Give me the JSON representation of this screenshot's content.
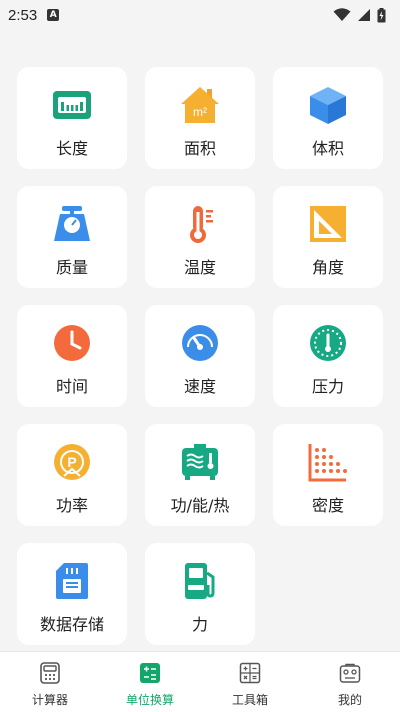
{
  "status_bar": {
    "time": "2:53",
    "notification_icon": "a-notification-icon"
  },
  "units": [
    {
      "label": "长度",
      "icon": "ruler-icon"
    },
    {
      "label": "面积",
      "icon": "house-area-icon"
    },
    {
      "label": "体积",
      "icon": "cube-icon"
    },
    {
      "label": "质量",
      "icon": "scale-icon"
    },
    {
      "label": "温度",
      "icon": "thermometer-icon"
    },
    {
      "label": "角度",
      "icon": "set-square-icon"
    },
    {
      "label": "时间",
      "icon": "clock-icon"
    },
    {
      "label": "速度",
      "icon": "speedometer-icon"
    },
    {
      "label": "压力",
      "icon": "pressure-gauge-icon"
    },
    {
      "label": "功率",
      "icon": "power-icon"
    },
    {
      "label": "功/能/热",
      "icon": "heater-icon"
    },
    {
      "label": "密度",
      "icon": "density-grid-icon"
    },
    {
      "label": "数据存储",
      "icon": "sd-card-icon"
    },
    {
      "label": "力",
      "icon": "fuel-pump-icon"
    }
  ],
  "tabs": [
    {
      "label": "计算器",
      "icon": "calculator-icon",
      "active": false
    },
    {
      "label": "单位换算",
      "icon": "unit-convert-icon",
      "active": true
    },
    {
      "label": "工具箱",
      "icon": "toolbox-icon",
      "active": false
    },
    {
      "label": "我的",
      "icon": "profile-icon",
      "active": false
    }
  ],
  "colors": {
    "active_tab": "#13a66b",
    "background": "#f4f4f4",
    "card": "#ffffff"
  }
}
